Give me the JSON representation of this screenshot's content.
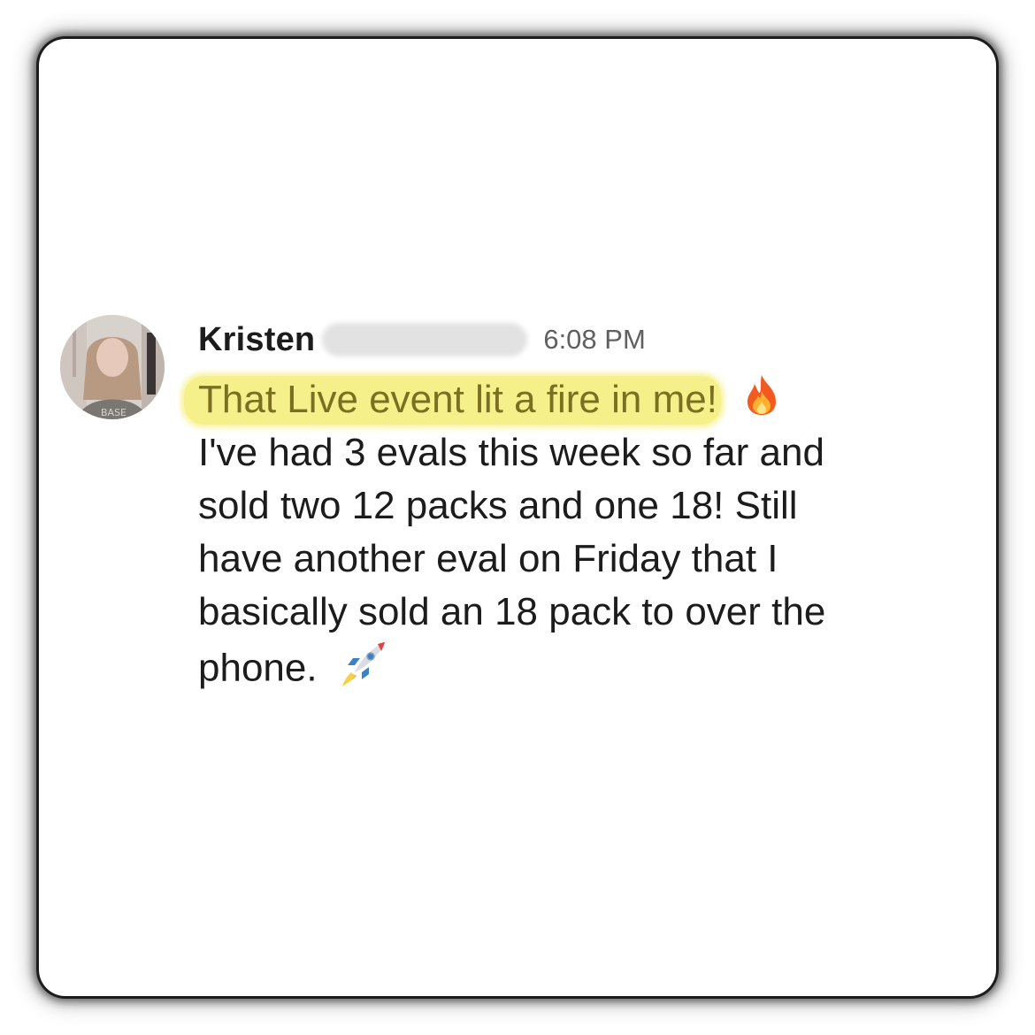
{
  "message": {
    "sender_name": "Kristen",
    "timestamp": "6:08 PM",
    "highlighted_text": "That Live event lit a fire in me!",
    "highlight_emoji": "fire-emoji",
    "body_lines": [
      "I've had 3 evals this week so far and",
      "sold two 12 packs and one 18! Still",
      "have another eval on Friday that I",
      "basically sold an 18 pack to over the",
      "phone."
    ],
    "closing_emoji": "rocket-emoji"
  },
  "colors": {
    "highlight": "#f6f08a",
    "highlight_text": "#7b6f23",
    "text": "#1d1c1d",
    "timestamp": "#616061"
  }
}
